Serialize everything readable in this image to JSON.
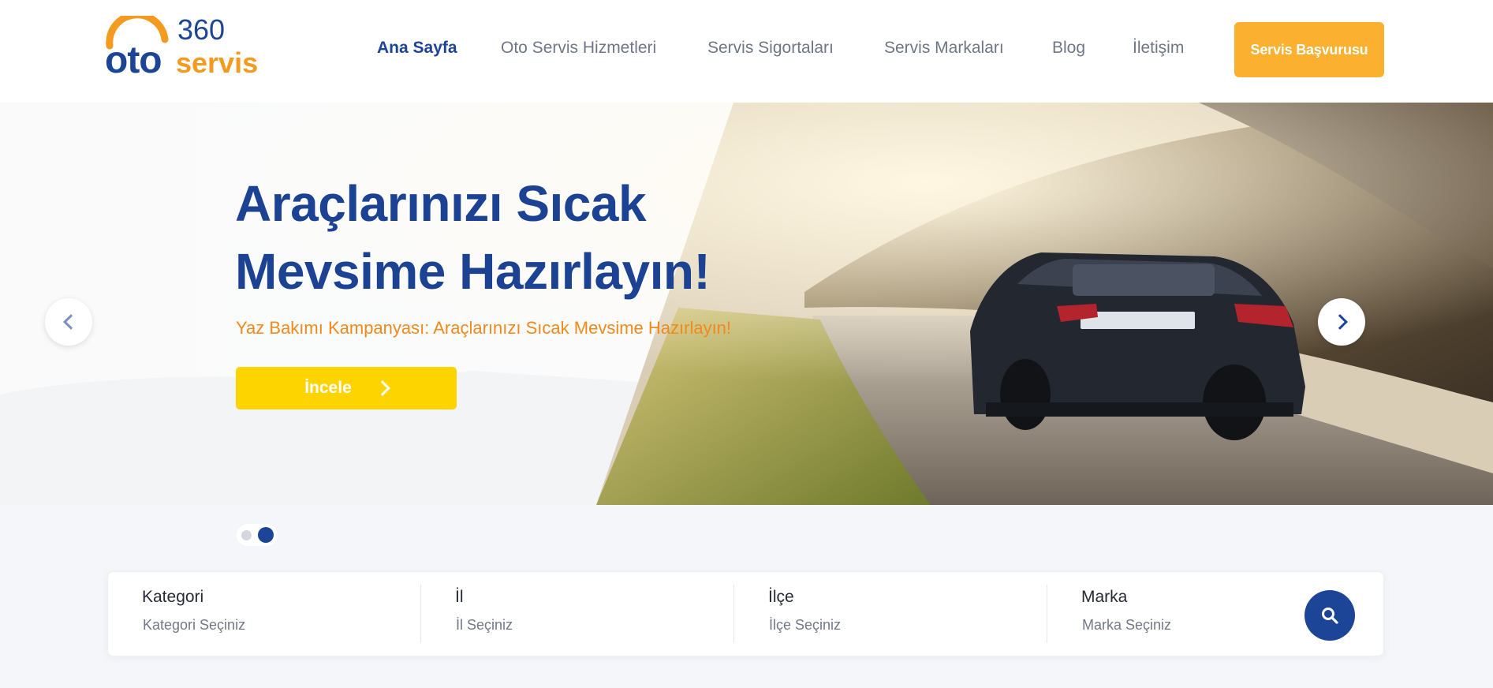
{
  "header": {
    "logo": {
      "top_text": "360",
      "main_text": "oto",
      "sub_text": "servis"
    },
    "nav": [
      {
        "label": "Ana Sayfa",
        "active": true
      },
      {
        "label": "Oto Servis Hizmetleri",
        "active": false
      },
      {
        "label": "Servis Sigortaları",
        "active": false
      },
      {
        "label": "Servis Markaları",
        "active": false
      },
      {
        "label": "Blog",
        "active": false
      },
      {
        "label": "İletişim",
        "active": false
      }
    ],
    "cta_label": "Servis Başvurusu"
  },
  "hero": {
    "title_line1": "Araçlarınızı Sıcak",
    "title_line2": "Mevsime Hazırlayın!",
    "subtitle": "Yaz Bakımı Kampanyası: Araçlarınızı Sıcak Mevsime Hazırlayın!",
    "button_label": "İncele",
    "prev_icon": "chevron-left-icon",
    "next_icon": "chevron-right-icon"
  },
  "carousel": {
    "slides": 2,
    "active_index": 2
  },
  "search": {
    "fields": [
      {
        "label": "Kategori",
        "placeholder": "Kategori Seçiniz"
      },
      {
        "label": "İl",
        "placeholder": "İl Seçiniz"
      },
      {
        "label": "İlçe",
        "placeholder": "İlçe Seçiniz"
      },
      {
        "label": "Marka",
        "placeholder": "Marka Seçiniz"
      }
    ],
    "button_icon": "search-icon"
  },
  "colors": {
    "brand_blue": "#1d4597",
    "brand_orange": "#f39a1f",
    "cta_orange": "#fbb030",
    "button_yellow": "#fed400"
  }
}
